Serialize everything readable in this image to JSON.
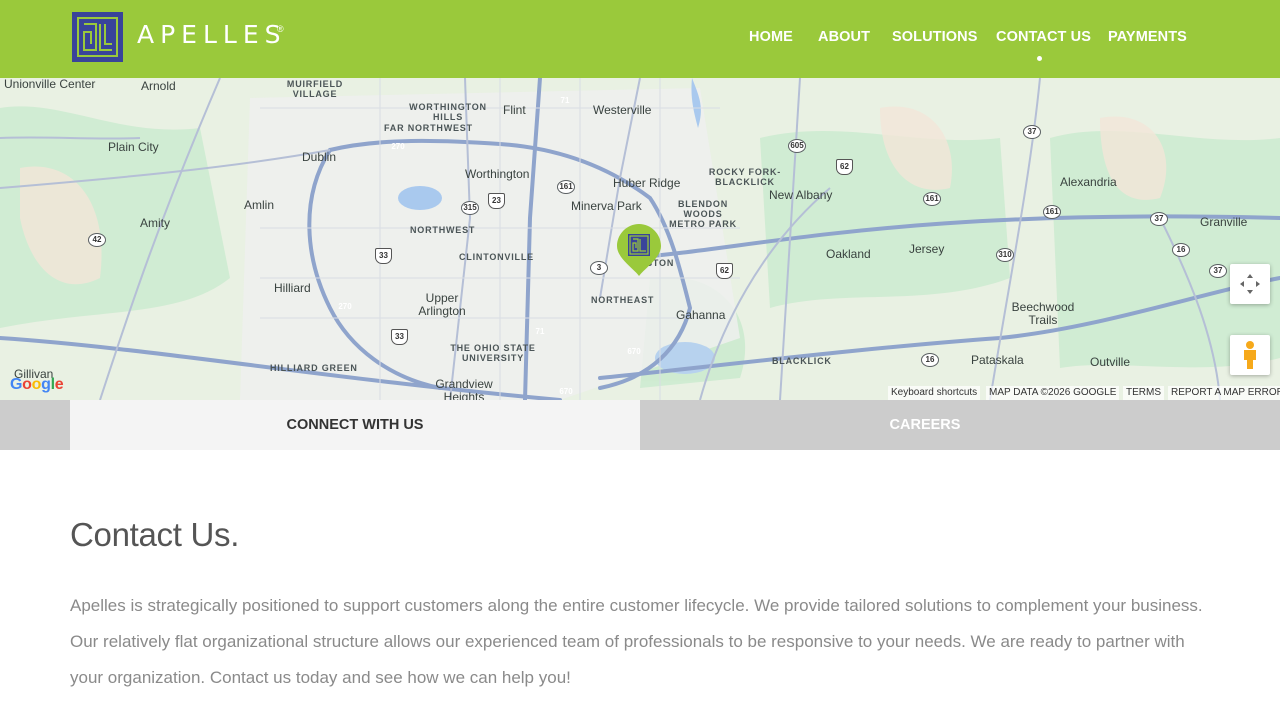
{
  "brand": {
    "name": "APELLES",
    "registered": "®",
    "logo_color": "#39449a"
  },
  "header": {
    "background": "#9ac93b"
  },
  "nav": {
    "items": [
      {
        "label": "HOME"
      },
      {
        "label": "ABOUT"
      },
      {
        "label": "SOLUTIONS"
      },
      {
        "label": "CONTACT US",
        "active": true
      },
      {
        "label": "PAYMENTS"
      }
    ]
  },
  "map": {
    "labels": {
      "unionville": "Unionville Center",
      "arnold": "Arnold",
      "muirfield": "MUIRFIELD VILLAGE",
      "worthington_hills": "WORTHINGTON HILLS",
      "flint": "Flint",
      "westerville": "Westerville",
      "far_northwest": "FAR NORTHWEST",
      "plain_city": "Plain City",
      "dublin": "Dublin",
      "worthington": "Worthington",
      "rocky_fork": "ROCKY FORK-BLACKLICK",
      "new_albany": "New Albany",
      "alexandria": "Alexandria",
      "amlin": "Amlin",
      "minerva_park": "Minerva Park",
      "blendon_woods": "BLENDON WOODS METRO PARK",
      "amity": "Amity",
      "northwest": "NORTHWEST",
      "clintonville": "CLINTONVILLE",
      "easton": "EASTON",
      "oakland": "Oakland",
      "jersey": "Jersey",
      "granville": "Granville",
      "hilliard": "Hilliard",
      "upper_arlington": "Upper Arlington",
      "northeast": "NORTHEAST",
      "gahanna": "Gahanna",
      "beechwood": "Beechwood Trails",
      "ohio_state": "THE OHIO STATE UNIVERSITY",
      "gillivan": "Gillivan",
      "hilliard_green": "HILLIARD GREEN",
      "grandview": "Grandview Heights",
      "blacklick": "BLACKLICK",
      "pataskala": "Pataskala",
      "outville": "Outville",
      "huber_ridge": "Huber Ridge"
    },
    "roads": {
      "r270a": "270",
      "r71a": "71",
      "r161a": "161",
      "r315": "315",
      "r23": "23",
      "r33a": "33",
      "r33b": "33",
      "r3": "3",
      "r62a": "62",
      "r62b": "62",
      "r605": "605",
      "r37a": "37",
      "r37b": "37",
      "r37c": "37",
      "r161b": "161",
      "r161c": "161",
      "r310": "310",
      "r16a": "16",
      "r16b": "16",
      "r42": "42",
      "r270b": "270",
      "r71b": "71",
      "r670a": "670",
      "r670b": "670"
    },
    "google_logo": "Google",
    "keyboard_shortcuts": "Keyboard shortcuts",
    "map_data": "MAP DATA ©2026 GOOGLE",
    "terms": "TERMS",
    "report": "REPORT A MAP ERROR"
  },
  "tabs": {
    "connect": "CONNECT WITH US",
    "careers": "CAREERS"
  },
  "content": {
    "title": "Contact Us.",
    "paragraph": "Apelles is strategically positioned to support customers along the entire customer lifecycle. We provide tailored solutions to complement your business. Our relatively flat organizational structure allows our experienced team of professionals to be responsive to your needs. We are ready to partner with your organization. Contact us today and see how we can help you!"
  }
}
